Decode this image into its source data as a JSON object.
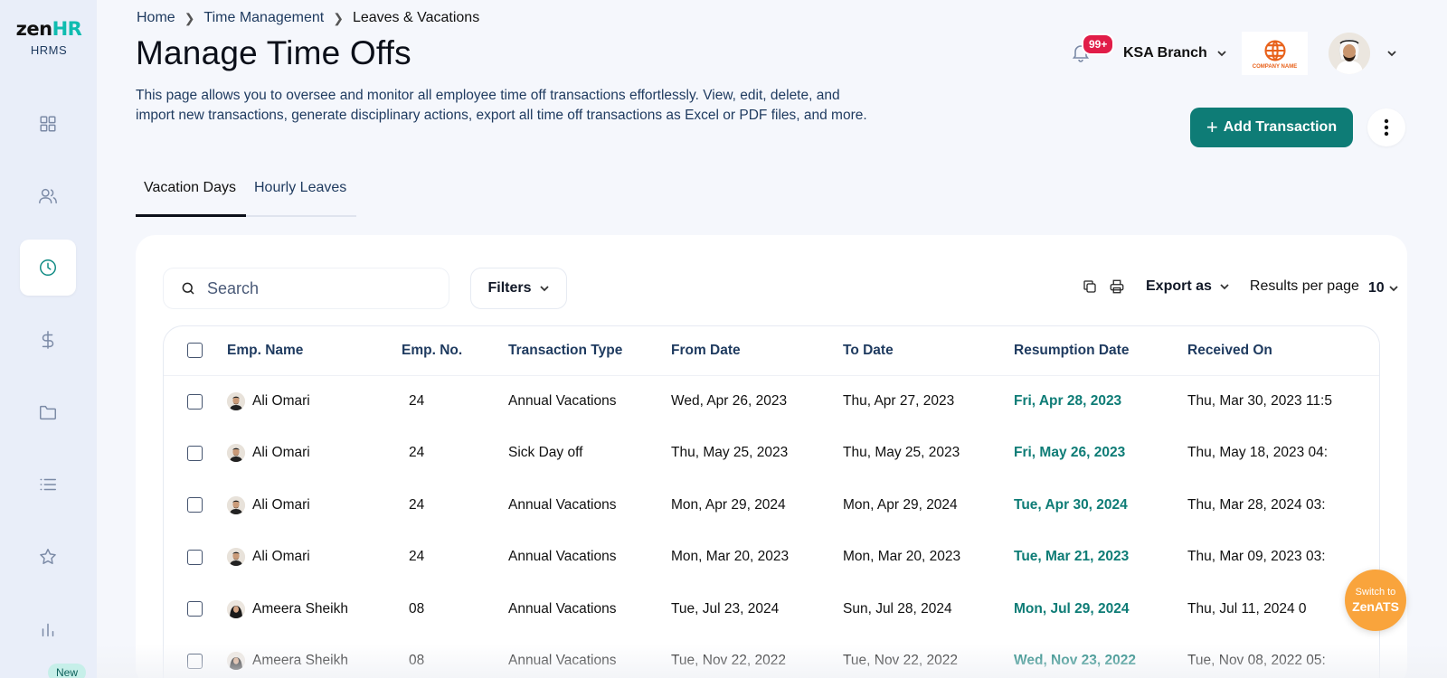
{
  "sidebar": {
    "logo_main_prefix": "zen",
    "logo_main_suffix": "HR",
    "logo_sub": "HRMS",
    "new_badge": "New",
    "items": [
      {
        "icon": "dashboard-icon",
        "active": false
      },
      {
        "icon": "people-icon",
        "active": false
      },
      {
        "icon": "clock-icon",
        "active": true
      },
      {
        "icon": "dollar-icon",
        "active": false
      },
      {
        "icon": "folder-icon",
        "active": false
      },
      {
        "icon": "list-icon",
        "active": false
      },
      {
        "icon": "star-icon",
        "active": false
      },
      {
        "icon": "bar-chart-icon",
        "active": false
      }
    ]
  },
  "breadcrumb": [
    "Home",
    "Time Management",
    "Leaves & Vacations"
  ],
  "page": {
    "title": "Manage Time Offs",
    "description": "This page allows you to oversee and monitor all employee time off transactions effortlessly. View, edit, delete, and import new transactions, generate disciplinary actions, export all time off transactions as Excel or PDF files, and more."
  },
  "header": {
    "notification_count": "99+",
    "branch": "KSA Branch",
    "company_logo_text": "COMPANY NAME"
  },
  "actions": {
    "add_transaction": "Add Transaction"
  },
  "tabs": [
    "Vacation Days",
    "Hourly Leaves"
  ],
  "toolbar": {
    "search_placeholder": "Search",
    "filters": "Filters",
    "export_as": "Export as",
    "results_per_page_label": "Results per page",
    "results_per_page_value": "10"
  },
  "table": {
    "columns": [
      "Emp. Name",
      "Emp. No.",
      "Transaction Type",
      "From Date",
      "To Date",
      "Resumption Date",
      "Received On"
    ],
    "rows": [
      {
        "name": "Ali Omari",
        "avatar": "male",
        "no": "24",
        "type": "Annual Vacations",
        "from": "Wed, Apr 26, 2023",
        "to": "Thu, Apr 27, 2023",
        "resume": "Fri, Apr 28, 2023",
        "received": "Thu, Mar 30, 2023 11:5"
      },
      {
        "name": "Ali Omari",
        "avatar": "male",
        "no": "24",
        "type": "Sick Day off",
        "from": "Thu, May 25, 2023",
        "to": "Thu, May 25, 2023",
        "resume": "Fri, May 26, 2023",
        "received": "Thu, May 18, 2023 04:"
      },
      {
        "name": "Ali Omari",
        "avatar": "male",
        "no": "24",
        "type": "Annual Vacations",
        "from": "Mon, Apr 29, 2024",
        "to": "Mon, Apr 29, 2024",
        "resume": "Tue, Apr 30, 2024",
        "received": "Thu, Mar 28, 2024 03:"
      },
      {
        "name": "Ali Omari",
        "avatar": "male",
        "no": "24",
        "type": "Annual Vacations",
        "from": "Mon, Mar 20, 2023",
        "to": "Mon, Mar 20, 2023",
        "resume": "Tue, Mar 21, 2023",
        "received": "Thu, Mar 09, 2023 03:"
      },
      {
        "name": "Ameera Sheikh",
        "avatar": "female",
        "no": "08",
        "type": "Annual Vacations",
        "from": "Tue, Jul 23, 2024",
        "to": "Sun, Jul 28, 2024",
        "resume": "Mon, Jul 29, 2024",
        "received": "Thu, Jul 11, 2024 0"
      },
      {
        "name": "Ameera Sheikh",
        "avatar": "female",
        "no": "08",
        "type": "Annual Vacations",
        "from": "Tue, Nov 22, 2022",
        "to": "Tue, Nov 22, 2022",
        "resume": "Wed, Nov 23, 2022",
        "received": "Tue, Nov 08, 2022 05:"
      }
    ]
  },
  "fab": {
    "line1": "Switch to",
    "line2": "ZenATS"
  },
  "colors": {
    "primary": "#0e7c76",
    "accent_logo": "#0fbcb0",
    "badge_red": "#e11d48",
    "fab_orange": "#f9a43c",
    "sidebar_bg": "#e9eef9",
    "page_bg": "#f5f7fc"
  }
}
